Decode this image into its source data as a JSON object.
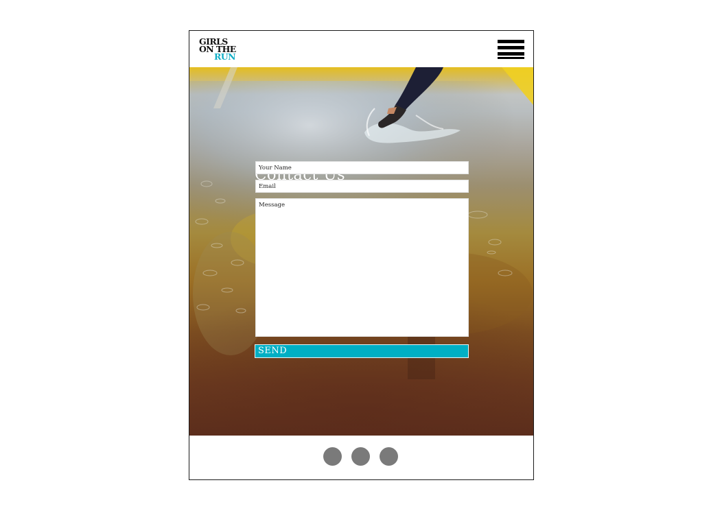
{
  "header": {
    "logo_line1": "GIRLS",
    "logo_line2": "ON THE",
    "logo_line3": "RUN",
    "menu_icon": "hamburger-menu-icon"
  },
  "contact": {
    "title": "Contact Us",
    "name_placeholder": "Your Name",
    "email_placeholder": "Email",
    "message_placeholder": "Message",
    "send_label": "SEND"
  },
  "footer": {
    "dots": [
      "social-link-1",
      "social-link-2",
      "social-link-3"
    ]
  },
  "colors": {
    "accent": "#00afc4",
    "logo_accent": "#12aec6",
    "dot": "#7a7a7a",
    "text": "#111111"
  }
}
